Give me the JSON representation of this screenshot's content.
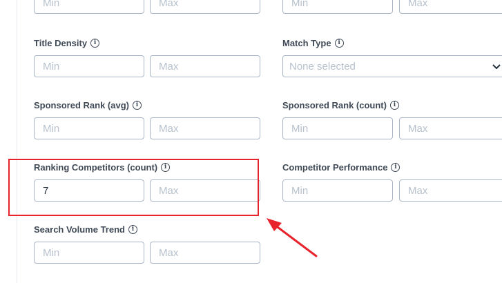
{
  "placeholders": {
    "min": "Min",
    "max": "Max"
  },
  "fields": {
    "title_density": {
      "label": "Title Density"
    },
    "match_type": {
      "label": "Match Type",
      "value": "None selected"
    },
    "sponsored_rank_avg": {
      "label": "Sponsored Rank (avg)"
    },
    "sponsored_rank_count": {
      "label": "Sponsored Rank (count)"
    },
    "ranking_competitors_count": {
      "label": "Ranking Competitors (count)",
      "min_value": "7"
    },
    "competitor_performance": {
      "label": "Competitor Performance"
    },
    "search_volume_trend": {
      "label": "Search Volume Trend"
    }
  },
  "icons": {
    "info": "info-circle-icon",
    "chevron": "chevron-down-icon"
  },
  "colors": {
    "highlight": "#e8232b",
    "field_border": "#a9b6c7",
    "label_text": "#3f4a56"
  }
}
